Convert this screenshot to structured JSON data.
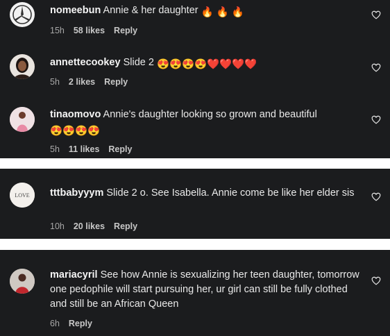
{
  "comments": [
    {
      "username": "nomeebun",
      "text": "Annie & her daughter",
      "emoji": "🔥 🔥 🔥",
      "time": "15h",
      "likes": "58 likes",
      "reply": "Reply"
    },
    {
      "username": "annettecookey",
      "text": "Slide 2",
      "emoji": "😍😍😍😍❤️❤️❤️❤️",
      "time": "5h",
      "likes": "2 likes",
      "reply": "Reply"
    },
    {
      "username": "tinaomovo",
      "text": "Annie's daughter looking so grown and beautiful",
      "emoji": "😍😍😍😍",
      "time": "5h",
      "likes": "11 likes",
      "reply": "Reply"
    },
    {
      "username": "tttbabyyym",
      "text": "Slide 2 o. See Isabella. Annie come be like her elder sis",
      "time": "10h",
      "likes": "20 likes",
      "reply": "Reply"
    },
    {
      "username": "mariacyril",
      "text": "See how Annie is sexualizing her teen daughter, tomorrow one pedophile will start pursuing her, ur girl can still be fully clothed and still be an African Queen",
      "time": "6h",
      "reply": "Reply"
    }
  ],
  "avatar_4_text": "LOVE",
  "colors": {
    "panel": "#1b1c1e",
    "divider": "#ffffff",
    "meta": "#a8a8a8"
  },
  "icons": {
    "like": "heart-outline-icon",
    "avatar_1": "mercedes-logo"
  }
}
